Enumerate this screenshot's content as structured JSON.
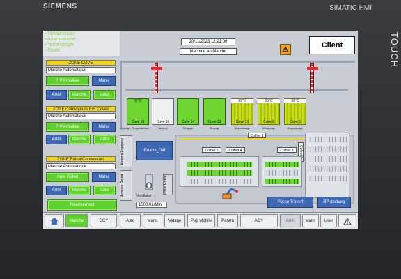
{
  "bezel": {
    "brand": "SIEMENS",
    "product": "SIMATIC HMI",
    "touch": "TOUCH"
  },
  "menu": {
    "items": [
      "Maintenance",
      "Automatisme",
      "Technologie",
      "Etude"
    ]
  },
  "header": {
    "datetime": "20/11/2023 12:21:06",
    "status": "Machine en Marche",
    "warning_icon": "warning-triangle-icon",
    "client_label": "Client"
  },
  "zone_cuve": {
    "title": "ZONE CUVE",
    "mode": "Marche Automatique",
    "btn_verrouillee": "P Vérrouillee",
    "btn_manu": "Manu",
    "btn_arret": "Arrêt",
    "btn_marche": "Marche",
    "btn_auto": "Auto"
  },
  "zone_convoyeurs": {
    "title": "ZONE Convoyeurs E/S Cuves",
    "mode": "Marche Automatique",
    "btn_verrouillee": "P Vérrouillee",
    "btn_manu": "Manu",
    "btn_arret": "Arrêt",
    "btn_marche": "Marche",
    "btn_auto": "Auto"
  },
  "zone_robot": {
    "title": "ZONE Robot/Convoyeurs",
    "mode": "Marche Automatique",
    "btn_robot": "Auto Robot",
    "btn_manu": "Manu",
    "btn_arret": "Arrêt",
    "btn_marche": "Marche",
    "btn_auto": "Auto"
  },
  "rearmement": "Réarmement",
  "armoires": {
    "frappeur": "Armoire Frappeur",
    "robot": "Armoire Robot",
    "poste": "Poste Robot"
  },
  "rearm_def": "Réarm_Déf",
  "ventilation": {
    "label": "Ventilation",
    "value": "1500,01/Min"
  },
  "tanks": [
    {
      "name": "Cuve 18",
      "temp": "57°C",
      "style": "green"
    },
    {
      "name": "Cuve 16",
      "temp": "",
      "style": "white"
    },
    {
      "name": "Cuve 14",
      "temp": "",
      "style": "green"
    },
    {
      "name": "Cuve 12",
      "temp": "",
      "style": "green"
    },
    {
      "name": "Cuve 10",
      "temp": "69°C",
      "style": "striped"
    },
    {
      "name": "Cuve 8",
      "temp": "38°C",
      "style": "striped"
    },
    {
      "name": "Cuve 6",
      "temp": "69°C",
      "style": "striped"
    }
  ],
  "process_labels": [
    "Lavage Phosphatation",
    "Tampon",
    "Rinçage",
    "Rinçage",
    "Dégraissage",
    "Décapage",
    "Dégraissage"
  ],
  "coffrets": [
    "Coffret 1",
    "Coffret 5",
    "Coffret 4",
    "Coffret 3",
    "Coffret 2"
  ],
  "actions": {
    "passe_travert": "Passe Travert",
    "bp_decharge": "BP decharg"
  },
  "nav": {
    "home_icon": "home-icon",
    "items": [
      "Marche",
      "DCY",
      "Auto",
      "Manu",
      "Vidage",
      "Pup Mobile",
      "Param",
      "ACY",
      "Arrêt",
      "Maint",
      "User"
    ],
    "alarm_icon": "warning-triangle-icon"
  },
  "colors": {
    "accent_green": "#5fd02c",
    "button_blue": "#3f6ab3",
    "zone_yellow": "#f0d41b",
    "warning_orange": "#f4a321"
  }
}
